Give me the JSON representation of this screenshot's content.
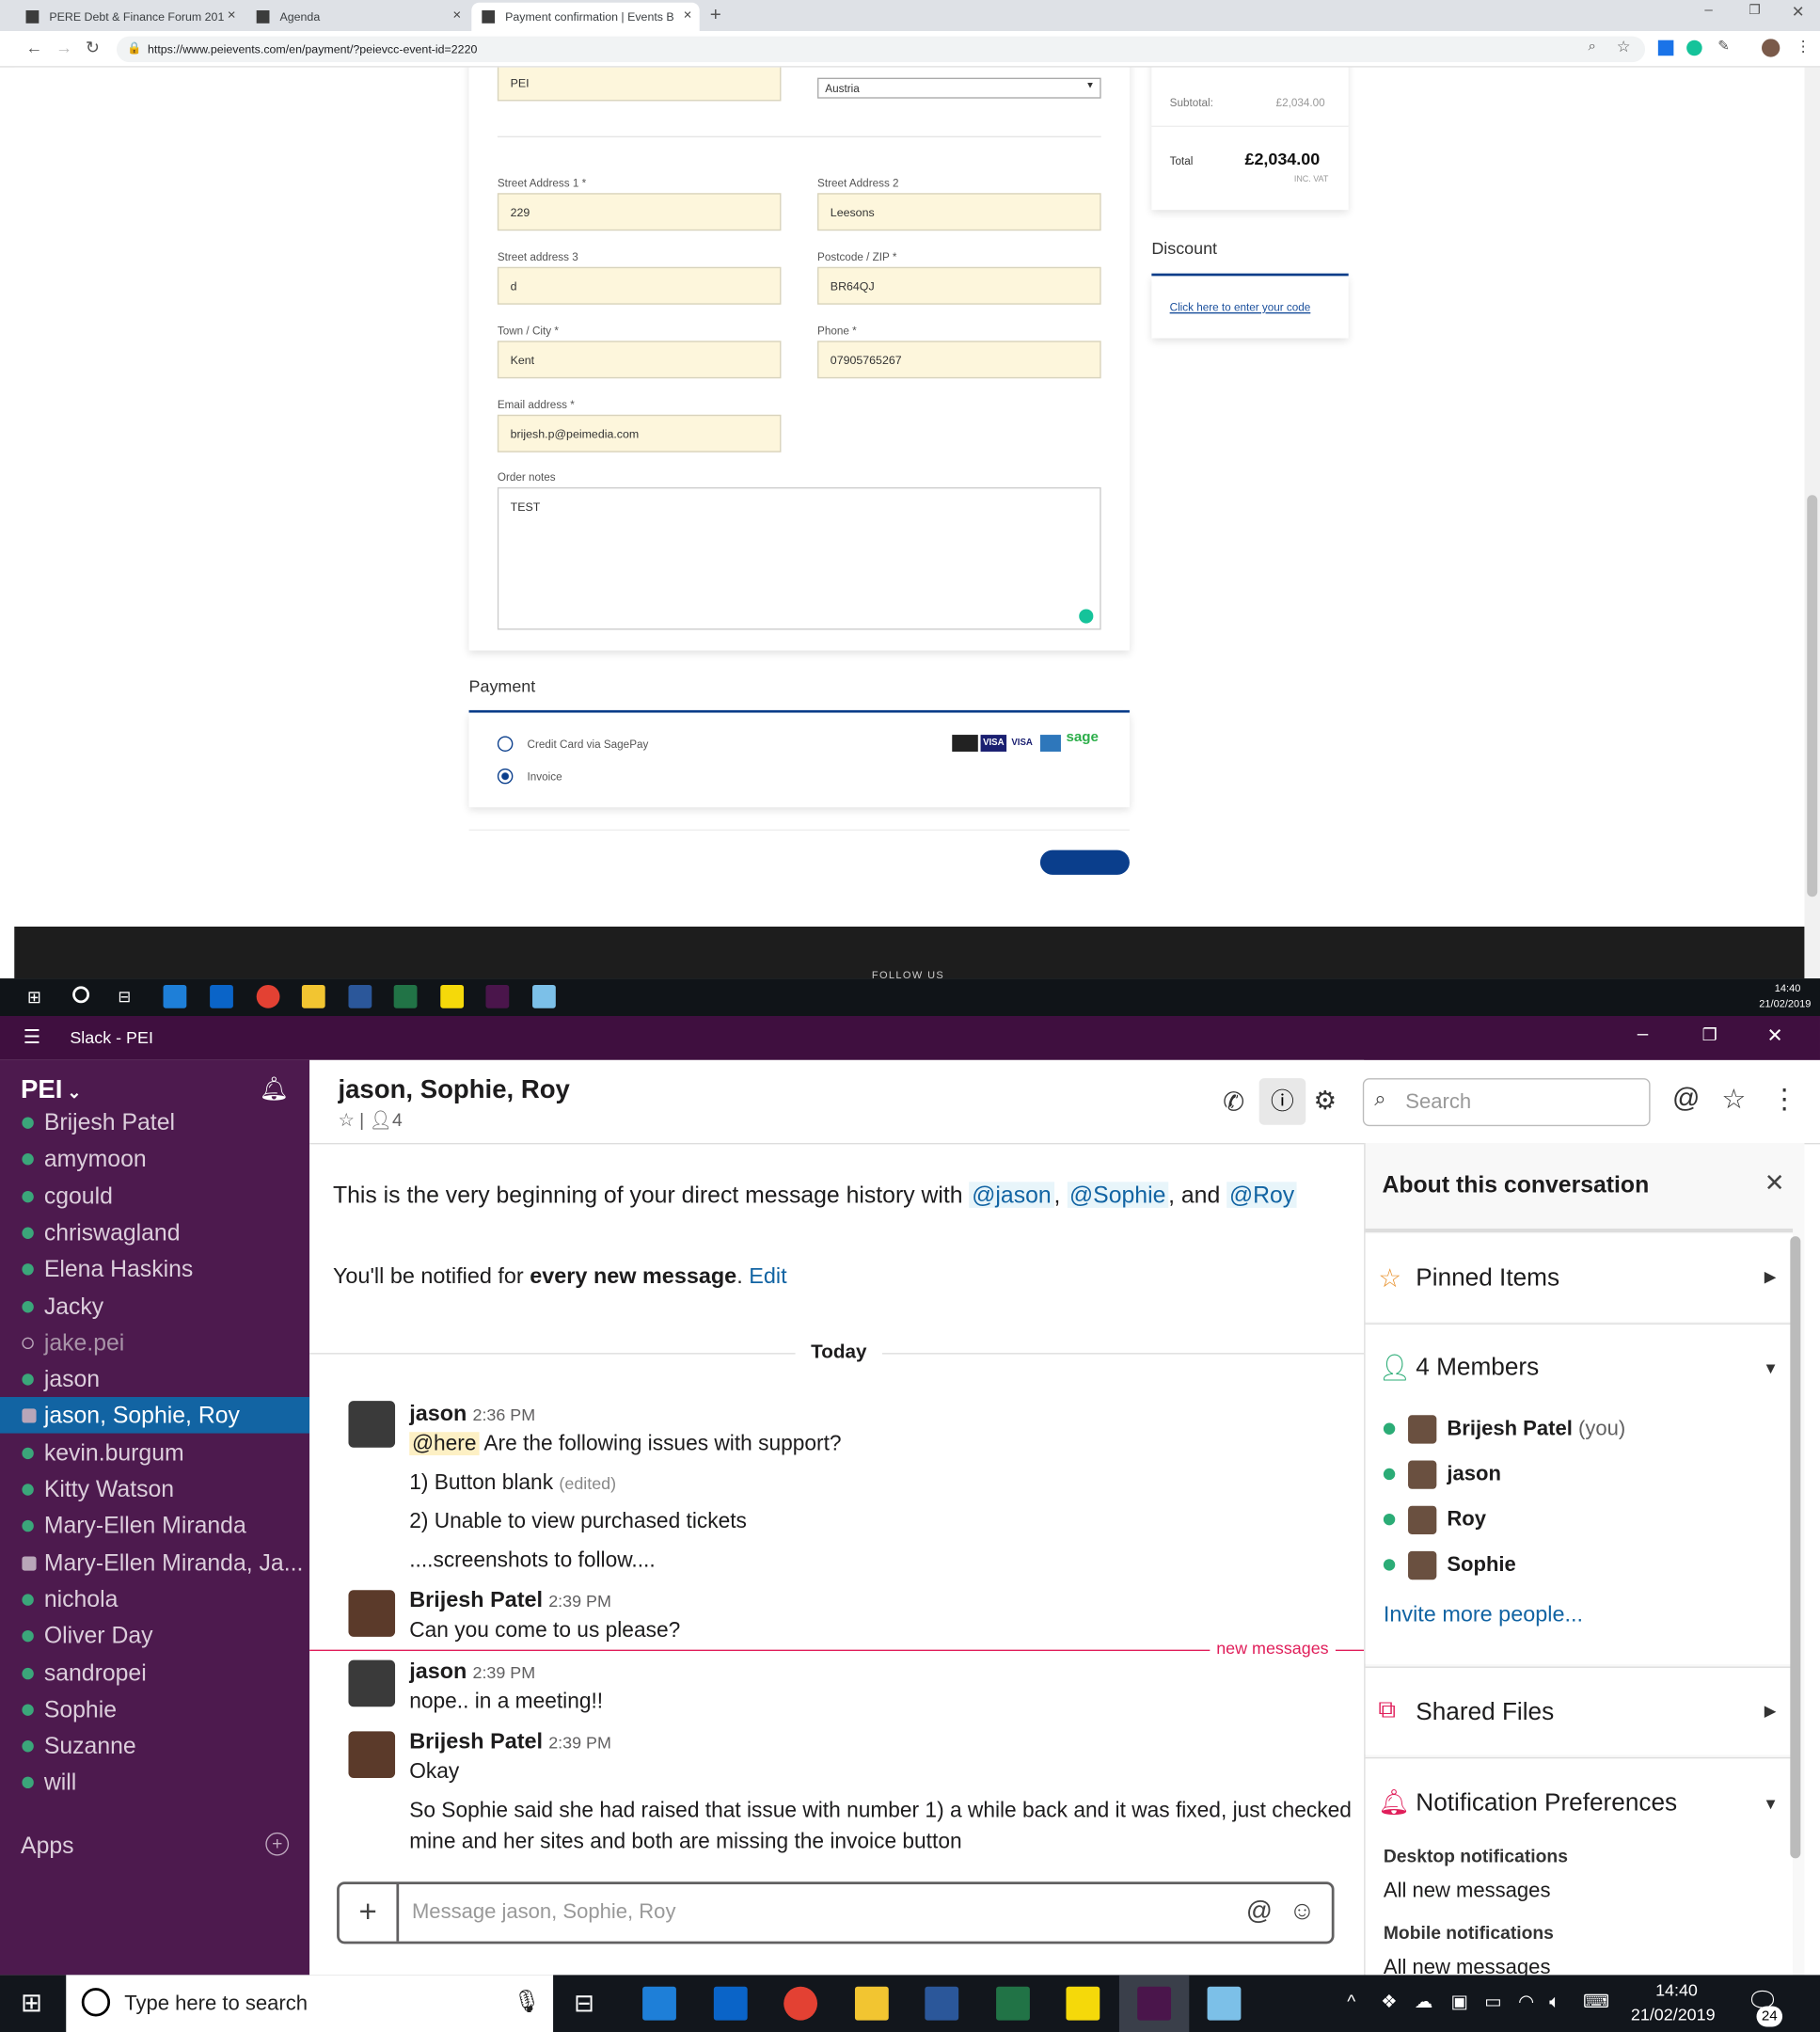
{
  "browser": {
    "tabs": [
      {
        "label": "PERE Debt & Finance Forum 201"
      },
      {
        "label": "Agenda"
      },
      {
        "label": "Payment confirmation | Events B"
      }
    ],
    "url": "https://www.peievents.com/en/payment/?peievcc-event-id=2220"
  },
  "form": {
    "company_value": "PEI",
    "country_value": "Austria",
    "street1_label": "Street Address 1 *",
    "street1_value": "229",
    "street2_label": "Street Address 2",
    "street2_value": "Leesons",
    "street3_label": "Street address 3",
    "street3_value": "d",
    "postcode_label": "Postcode / ZIP *",
    "postcode_value": "BR64QJ",
    "town_label": "Town / City *",
    "town_value": "Kent",
    "phone_label": "Phone *",
    "phone_value": "07905765267",
    "email_label": "Email address *",
    "email_value": "brijesh.p@peimedia.com",
    "notes_label": "Order notes",
    "notes_value": "TEST"
  },
  "payment": {
    "title": "Payment",
    "option_card": "Credit Card via SagePay",
    "option_invoice": "Invoice",
    "selected": "Invoice",
    "footer_text": "FOLLOW US"
  },
  "summary": {
    "subtotal_label": "Subtotal:",
    "subtotal_value": "£2,034.00",
    "total_label": "Total",
    "total_value": "£2,034.00",
    "vat_note": "INC. VAT",
    "discount_title": "Discount",
    "discount_link": "Click here to enter your code"
  },
  "taskbar1": {
    "time": "14:40",
    "date": "21/02/2019"
  },
  "slack": {
    "window_title": "Slack - PEI",
    "workspace": "PEI",
    "channels": [
      {
        "name": "Brijesh Patel",
        "status": "online"
      },
      {
        "name": "amymoon",
        "status": "online"
      },
      {
        "name": "cgould",
        "status": "online"
      },
      {
        "name": "chriswagland",
        "status": "online"
      },
      {
        "name": "Elena Haskins",
        "status": "online"
      },
      {
        "name": "Jacky",
        "status": "online"
      },
      {
        "name": "jake.pei",
        "status": "away"
      },
      {
        "name": "jason",
        "status": "online"
      },
      {
        "name": "jason, Sophie, Roy",
        "status": "group"
      },
      {
        "name": "kevin.burgum",
        "status": "online"
      },
      {
        "name": "Kitty Watson",
        "status": "online"
      },
      {
        "name": "Mary-Ellen Miranda",
        "status": "online"
      },
      {
        "name": "Mary-Ellen Miranda, Ja...",
        "status": "group"
      },
      {
        "name": "nichola",
        "status": "online"
      },
      {
        "name": "Oliver Day",
        "status": "online"
      },
      {
        "name": "sandropei",
        "status": "online"
      },
      {
        "name": "Sophie",
        "status": "online"
      },
      {
        "name": "Suzanne",
        "status": "online"
      },
      {
        "name": "will",
        "status": "online"
      }
    ],
    "apps_label": "Apps",
    "conversation_title": "jason, Sophie, Roy",
    "member_count": "4",
    "search_placeholder": "Search",
    "intro_text": "This is the very beginning of your direct message history with",
    "intro_mentions": [
      "@jason",
      "@Sophie",
      "@Roy"
    ],
    "intro_and": ", and",
    "notify_prefix": "You'll be notified for",
    "notify_bold": "every new message",
    "notify_edit": "Edit",
    "day_divider": "Today",
    "new_messages_label": "new messages",
    "messages": [
      {
        "author": "jason",
        "time": "2:36 PM",
        "lines": [
          "Are the following issues with support?",
          "1) Button blank",
          "2) Unable to view purchased tickets",
          "....screenshots to follow...."
        ],
        "mention": "@here",
        "edited": "(edited)"
      },
      {
        "author": "Brijesh Patel",
        "time": "2:39 PM",
        "lines": [
          "Can you come to us please?"
        ]
      },
      {
        "author": "jason",
        "time": "2:39 PM",
        "lines": [
          "nope.. in a meeting!!"
        ]
      },
      {
        "author": "Brijesh Patel",
        "time": "2:39 PM",
        "lines": [
          "Okay",
          "So Sophie said she had raised that issue with number 1) a while back and it was fixed, just checked",
          "mine and her sites and both are missing the invoice button"
        ]
      }
    ],
    "composer_placeholder": "Message jason, Sophie, Roy",
    "about": {
      "title": "About this conversation",
      "pinned": "Pinned Items",
      "members_title": "4 Members",
      "members": [
        {
          "name": "Brijesh Patel",
          "suffix": "(you)"
        },
        {
          "name": "jason",
          "suffix": ""
        },
        {
          "name": "Roy",
          "suffix": ""
        },
        {
          "name": "Sophie",
          "suffix": ""
        }
      ],
      "invite": "Invite more people...",
      "shared_files": "Shared Files",
      "notif_title": "Notification Preferences",
      "desktop_label": "Desktop notifications",
      "desktop_value": "All new messages",
      "mobile_label": "Mobile notifications",
      "mobile_value": "All new messages"
    }
  },
  "taskbar2": {
    "search_placeholder": "Type here to search",
    "time": "14:40",
    "date": "21/02/2019",
    "notif_count": "24"
  },
  "colors": {
    "slack_sidebar": "#4d1a4e",
    "slack_active": "#1264a3",
    "pei_blue": "#0a3e8c",
    "input_bg": "#fdf6dc"
  }
}
